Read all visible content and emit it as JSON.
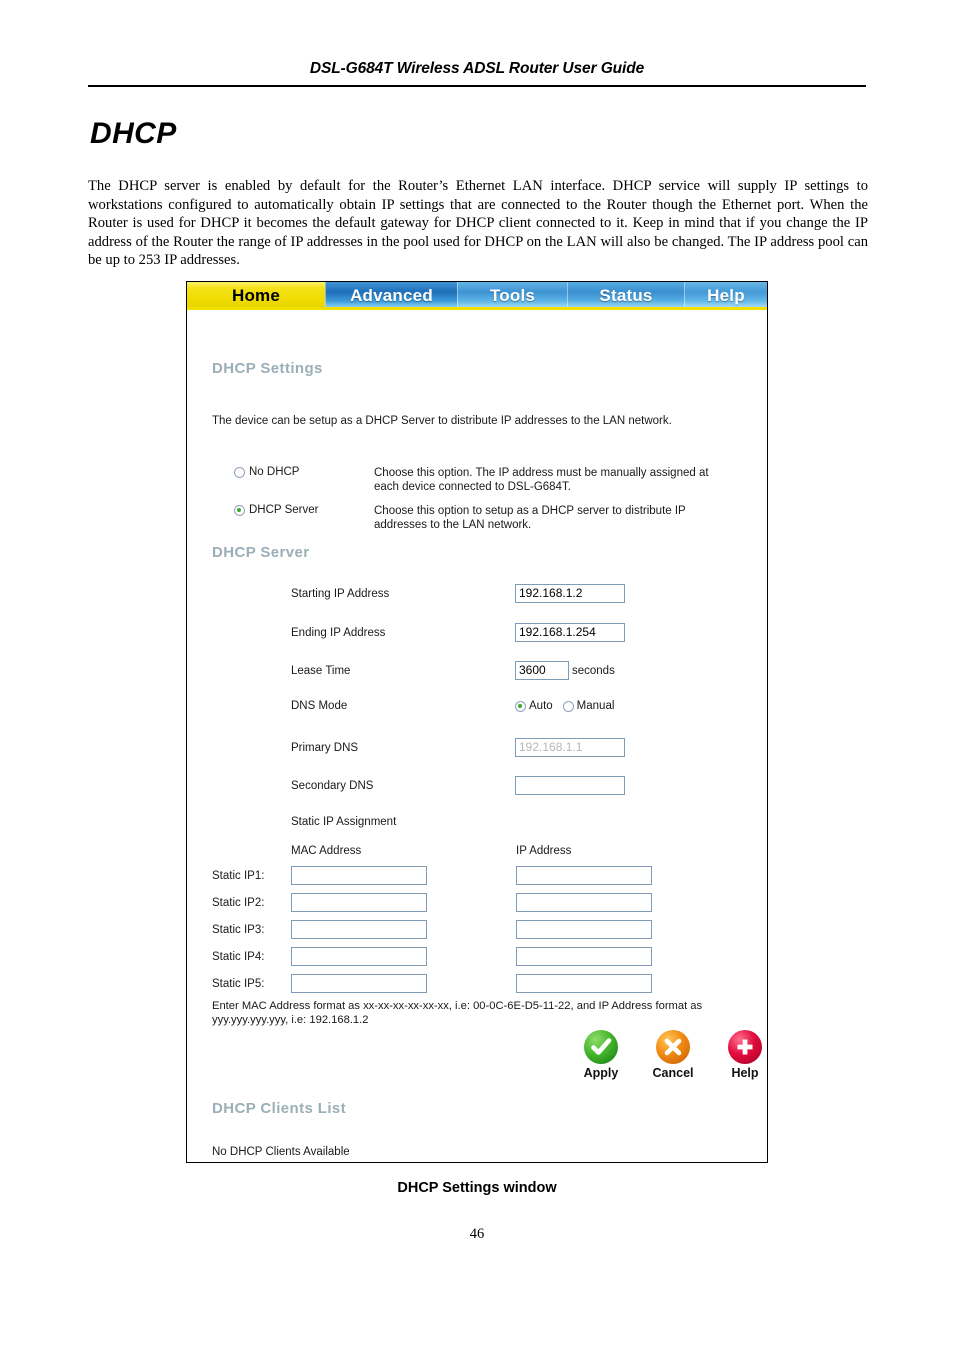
{
  "document": {
    "running_header": "DSL-G684T Wireless ADSL Router User Guide",
    "title": "DHCP",
    "paragraph": "The DHCP server is enabled by default for the Router’s Ethernet LAN interface. DHCP service will supply IP settings to workstations configured to automatically obtain IP settings that are connected to the Router though the Ethernet port. When the Router is used for DHCP it becomes the default gateway for DHCP client connected to it. Keep in mind that if you change the IP address of the Router the range of IP addresses in the pool used for DHCP on the LAN will also be changed. The IP address pool can be up to 253 IP addresses.",
    "figure_caption": "DHCP Settings window",
    "page_number": "46"
  },
  "screenshot": {
    "nav": {
      "active": "Home",
      "tabs": [
        {
          "label": "Home"
        },
        {
          "label": "Advanced"
        },
        {
          "label": "Tools"
        },
        {
          "label": "Status"
        },
        {
          "label": "Help"
        }
      ]
    },
    "settings": {
      "heading": "DHCP Settings",
      "intro": "The device can be setup as a DHCP Server to distribute IP addresses to the LAN network.",
      "mode_options": [
        {
          "label": "No DHCP",
          "selected": false,
          "description_line1": "Choose this option. The IP address must be manually assigned at",
          "description_line2": "each device connected to DSL-G684T."
        },
        {
          "label": "DHCP Server",
          "selected": true,
          "description_line1": "Choose this option to setup as a DHCP server to distribute IP",
          "description_line2": "addresses to the LAN network."
        }
      ]
    },
    "server": {
      "heading": "DHCP Server",
      "starting_ip_label": "Starting IP Address",
      "starting_ip_value": "192.168.1.2",
      "ending_ip_label": "Ending IP Address",
      "ending_ip_value": "192.168.1.254",
      "lease_time_label": "Lease Time",
      "lease_time_value": "3600",
      "lease_time_unit": "seconds",
      "dns_mode_label": "DNS Mode",
      "dns_mode_auto": "Auto",
      "dns_mode_manual": "Manual",
      "dns_mode_selected": "Auto",
      "primary_dns_label": "Primary DNS",
      "primary_dns_value": "192.168.1.1",
      "secondary_dns_label": "Secondary DNS",
      "secondary_dns_value": ""
    },
    "static_ip": {
      "section_label": "Static IP Assignment",
      "col_mac": "MAC Address",
      "col_ip": "IP Address",
      "rows": [
        {
          "label": "Static IP1:",
          "mac": "",
          "ip": ""
        },
        {
          "label": "Static IP2:",
          "mac": "",
          "ip": ""
        },
        {
          "label": "Static IP3:",
          "mac": "",
          "ip": ""
        },
        {
          "label": "Static IP4:",
          "mac": "",
          "ip": ""
        },
        {
          "label": "Static IP5:",
          "mac": "",
          "ip": ""
        }
      ],
      "note_line1": "Enter MAC Address format as xx-xx-xx-xx-xx-xx, i.e: 00-0C-6E-D5-11-22, and IP Address format as",
      "note_line2": "yyy.yyy.yyy.yyy, i.e: 192.168.1.2"
    },
    "actions": [
      {
        "label": "Apply",
        "icon": "check-circle-icon",
        "color": "#46b52c"
      },
      {
        "label": "Cancel",
        "icon": "x-circle-icon",
        "color": "#f08a12"
      },
      {
        "label": "Help",
        "icon": "plus-circle-icon",
        "color": "#e00b3c"
      }
    ],
    "clients": {
      "heading": "DHCP Clients List",
      "empty_message": "No DHCP Clients Available"
    }
  }
}
